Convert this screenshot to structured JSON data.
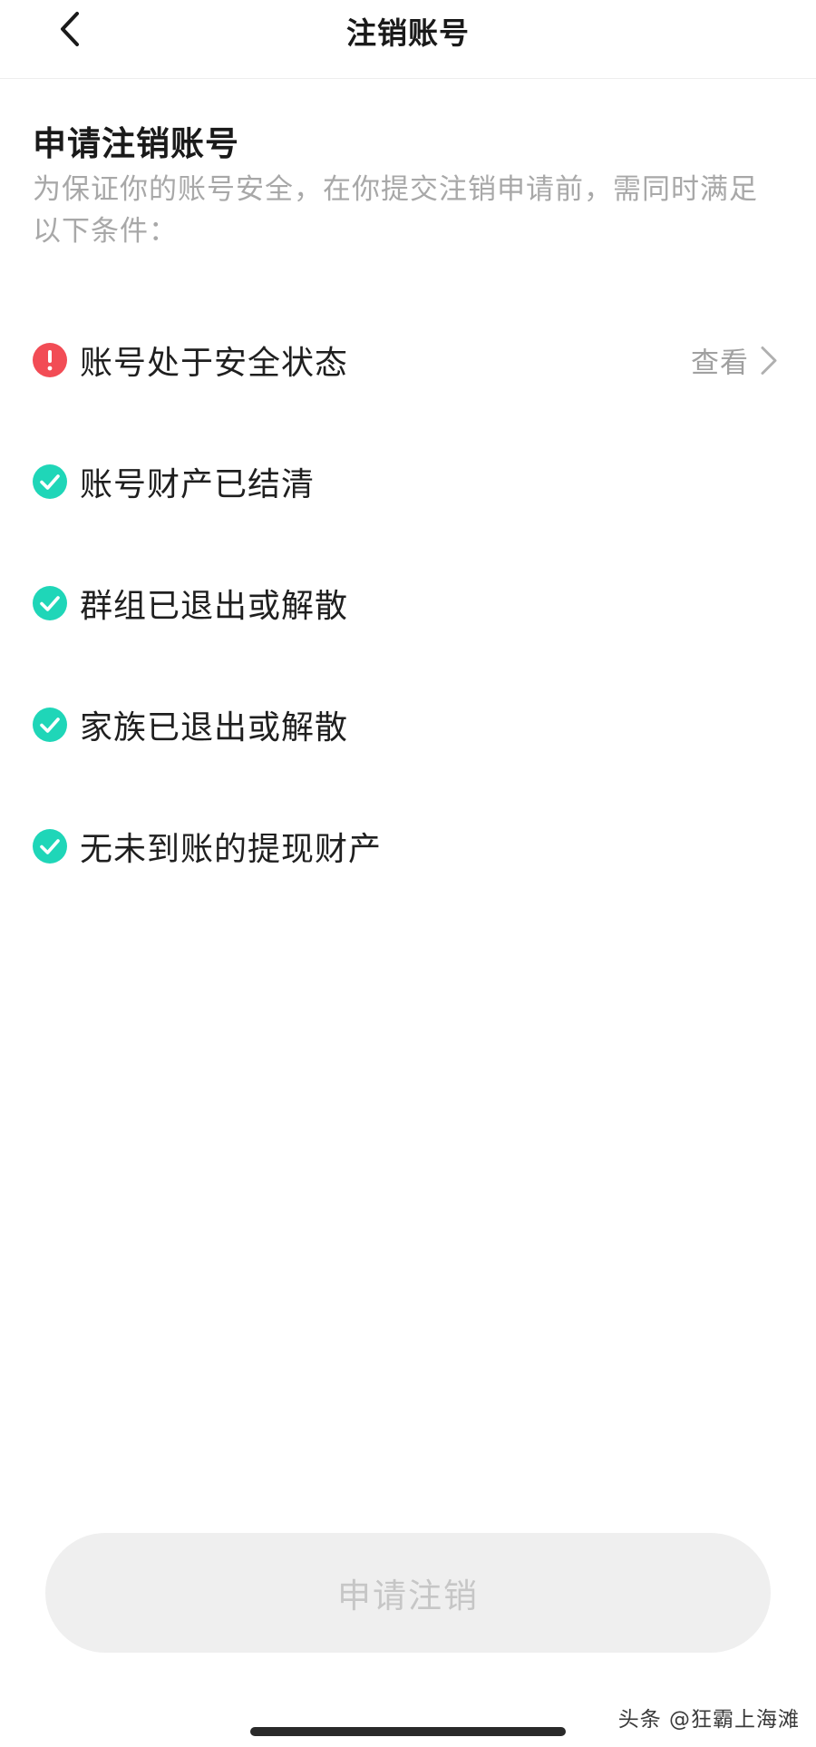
{
  "nav": {
    "title": "注销账号",
    "back_icon": "chevron-left-icon"
  },
  "section": {
    "title": "申请注销账号",
    "description": "为保证你的账号安全，在你提交注销申请前，需同时满足以下条件："
  },
  "conditions": [
    {
      "label": "账号处于安全状态",
      "status": "warning",
      "icon": "alert-icon",
      "action_label": "查看"
    },
    {
      "label": "账号财产已结清",
      "status": "ok",
      "icon": "check-circle-icon"
    },
    {
      "label": "群组已退出或解散",
      "status": "ok",
      "icon": "check-circle-icon"
    },
    {
      "label": "家族已退出或解散",
      "status": "ok",
      "icon": "check-circle-icon"
    },
    {
      "label": "无未到账的提现财产",
      "status": "ok",
      "icon": "check-circle-icon"
    }
  ],
  "submit": {
    "label": "申请注销",
    "enabled": false
  },
  "watermark": {
    "text": "头条 @狂霸上海滩"
  },
  "colors": {
    "warning": "#f24c55",
    "ok": "#1fd6b8",
    "muted_text": "#a8a8a8",
    "button_bg": "#efefef",
    "button_text": "#c6c6c6"
  }
}
